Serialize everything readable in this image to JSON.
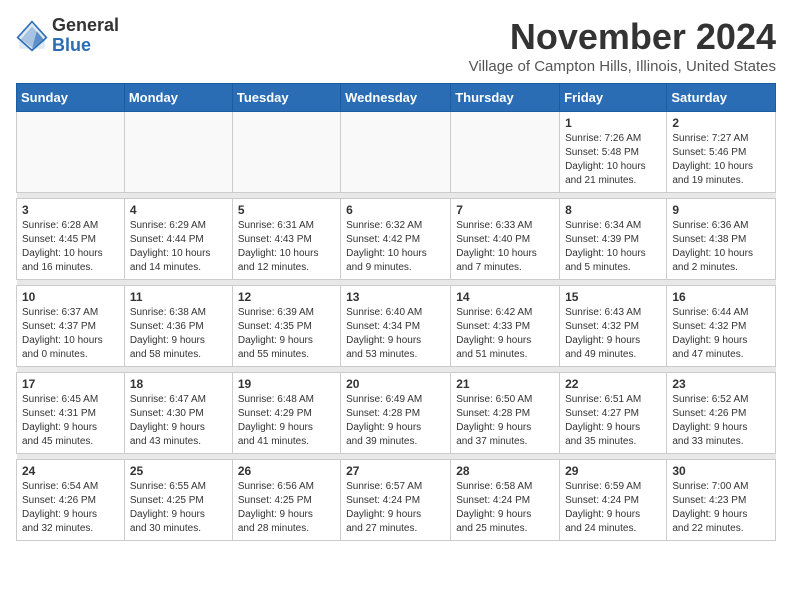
{
  "logo": {
    "general": "General",
    "blue": "Blue"
  },
  "header": {
    "month_title": "November 2024",
    "subtitle": "Village of Campton Hills, Illinois, United States"
  },
  "weekdays": [
    "Sunday",
    "Monday",
    "Tuesday",
    "Wednesday",
    "Thursday",
    "Friday",
    "Saturday"
  ],
  "weeks": [
    [
      {
        "day": "",
        "info": ""
      },
      {
        "day": "",
        "info": ""
      },
      {
        "day": "",
        "info": ""
      },
      {
        "day": "",
        "info": ""
      },
      {
        "day": "",
        "info": ""
      },
      {
        "day": "1",
        "info": "Sunrise: 7:26 AM\nSunset: 5:48 PM\nDaylight: 10 hours\nand 21 minutes."
      },
      {
        "day": "2",
        "info": "Sunrise: 7:27 AM\nSunset: 5:46 PM\nDaylight: 10 hours\nand 19 minutes."
      }
    ],
    [
      {
        "day": "3",
        "info": "Sunrise: 6:28 AM\nSunset: 4:45 PM\nDaylight: 10 hours\nand 16 minutes."
      },
      {
        "day": "4",
        "info": "Sunrise: 6:29 AM\nSunset: 4:44 PM\nDaylight: 10 hours\nand 14 minutes."
      },
      {
        "day": "5",
        "info": "Sunrise: 6:31 AM\nSunset: 4:43 PM\nDaylight: 10 hours\nand 12 minutes."
      },
      {
        "day": "6",
        "info": "Sunrise: 6:32 AM\nSunset: 4:42 PM\nDaylight: 10 hours\nand 9 minutes."
      },
      {
        "day": "7",
        "info": "Sunrise: 6:33 AM\nSunset: 4:40 PM\nDaylight: 10 hours\nand 7 minutes."
      },
      {
        "day": "8",
        "info": "Sunrise: 6:34 AM\nSunset: 4:39 PM\nDaylight: 10 hours\nand 5 minutes."
      },
      {
        "day": "9",
        "info": "Sunrise: 6:36 AM\nSunset: 4:38 PM\nDaylight: 10 hours\nand 2 minutes."
      }
    ],
    [
      {
        "day": "10",
        "info": "Sunrise: 6:37 AM\nSunset: 4:37 PM\nDaylight: 10 hours\nand 0 minutes."
      },
      {
        "day": "11",
        "info": "Sunrise: 6:38 AM\nSunset: 4:36 PM\nDaylight: 9 hours\nand 58 minutes."
      },
      {
        "day": "12",
        "info": "Sunrise: 6:39 AM\nSunset: 4:35 PM\nDaylight: 9 hours\nand 55 minutes."
      },
      {
        "day": "13",
        "info": "Sunrise: 6:40 AM\nSunset: 4:34 PM\nDaylight: 9 hours\nand 53 minutes."
      },
      {
        "day": "14",
        "info": "Sunrise: 6:42 AM\nSunset: 4:33 PM\nDaylight: 9 hours\nand 51 minutes."
      },
      {
        "day": "15",
        "info": "Sunrise: 6:43 AM\nSunset: 4:32 PM\nDaylight: 9 hours\nand 49 minutes."
      },
      {
        "day": "16",
        "info": "Sunrise: 6:44 AM\nSunset: 4:32 PM\nDaylight: 9 hours\nand 47 minutes."
      }
    ],
    [
      {
        "day": "17",
        "info": "Sunrise: 6:45 AM\nSunset: 4:31 PM\nDaylight: 9 hours\nand 45 minutes."
      },
      {
        "day": "18",
        "info": "Sunrise: 6:47 AM\nSunset: 4:30 PM\nDaylight: 9 hours\nand 43 minutes."
      },
      {
        "day": "19",
        "info": "Sunrise: 6:48 AM\nSunset: 4:29 PM\nDaylight: 9 hours\nand 41 minutes."
      },
      {
        "day": "20",
        "info": "Sunrise: 6:49 AM\nSunset: 4:28 PM\nDaylight: 9 hours\nand 39 minutes."
      },
      {
        "day": "21",
        "info": "Sunrise: 6:50 AM\nSunset: 4:28 PM\nDaylight: 9 hours\nand 37 minutes."
      },
      {
        "day": "22",
        "info": "Sunrise: 6:51 AM\nSunset: 4:27 PM\nDaylight: 9 hours\nand 35 minutes."
      },
      {
        "day": "23",
        "info": "Sunrise: 6:52 AM\nSunset: 4:26 PM\nDaylight: 9 hours\nand 33 minutes."
      }
    ],
    [
      {
        "day": "24",
        "info": "Sunrise: 6:54 AM\nSunset: 4:26 PM\nDaylight: 9 hours\nand 32 minutes."
      },
      {
        "day": "25",
        "info": "Sunrise: 6:55 AM\nSunset: 4:25 PM\nDaylight: 9 hours\nand 30 minutes."
      },
      {
        "day": "26",
        "info": "Sunrise: 6:56 AM\nSunset: 4:25 PM\nDaylight: 9 hours\nand 28 minutes."
      },
      {
        "day": "27",
        "info": "Sunrise: 6:57 AM\nSunset: 4:24 PM\nDaylight: 9 hours\nand 27 minutes."
      },
      {
        "day": "28",
        "info": "Sunrise: 6:58 AM\nSunset: 4:24 PM\nDaylight: 9 hours\nand 25 minutes."
      },
      {
        "day": "29",
        "info": "Sunrise: 6:59 AM\nSunset: 4:24 PM\nDaylight: 9 hours\nand 24 minutes."
      },
      {
        "day": "30",
        "info": "Sunrise: 7:00 AM\nSunset: 4:23 PM\nDaylight: 9 hours\nand 22 minutes."
      }
    ]
  ]
}
